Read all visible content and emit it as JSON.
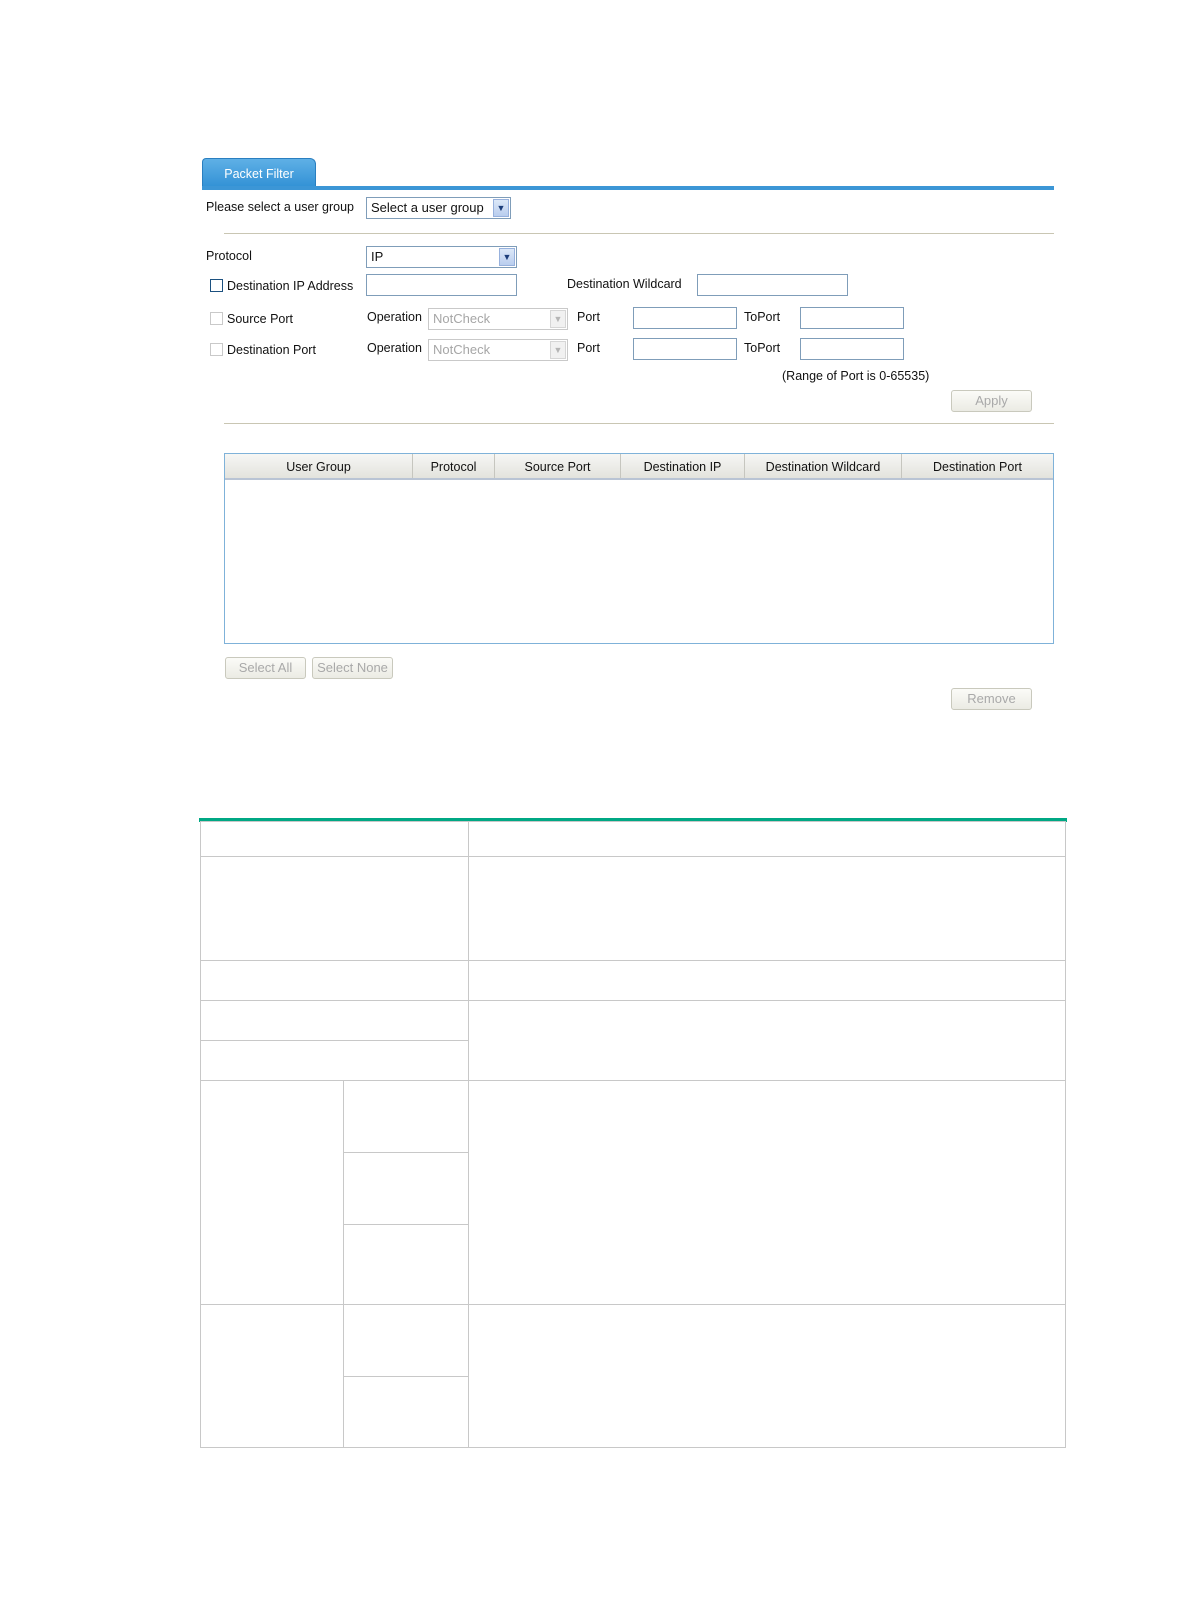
{
  "tab": {
    "label": "Packet Filter"
  },
  "user_group": {
    "label": "Please select a user group",
    "select_value": "Select a user group"
  },
  "protocol": {
    "label": "Protocol",
    "value": "IP"
  },
  "dest_ip": {
    "label": "Destination IP Address",
    "wildcard_label": "Destination Wildcard"
  },
  "source_port": {
    "label": "Source Port",
    "operation_label": "Operation",
    "operation_value": "NotCheck",
    "port_label": "Port",
    "toport_label": "ToPort"
  },
  "dest_port": {
    "label": "Destination Port",
    "operation_label": "Operation",
    "operation_value": "NotCheck",
    "port_label": "Port",
    "toport_label": "ToPort"
  },
  "range_note": "(Range of Port is 0-65535)",
  "buttons": {
    "apply": "Apply",
    "select_all": "Select All",
    "select_none": "Select None",
    "remove": "Remove"
  },
  "list": {
    "columns": [
      "User Group",
      "Protocol",
      "Source Port",
      "Destination IP",
      "Destination Wildcard",
      "Destination Port"
    ]
  }
}
